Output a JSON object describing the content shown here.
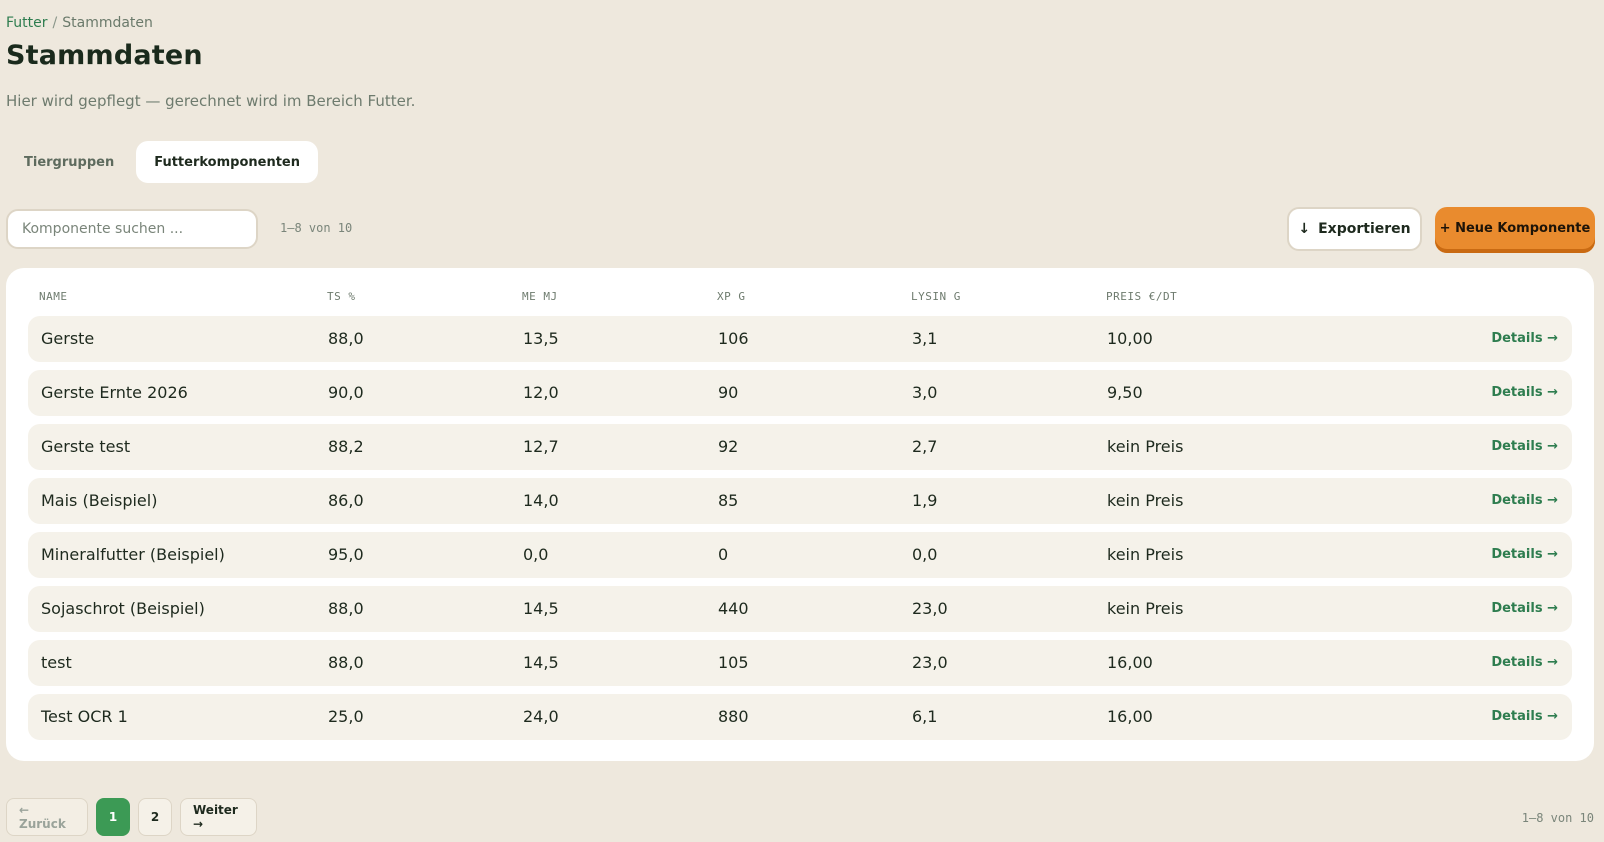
{
  "breadcrumb": {
    "parent": "Futter",
    "separator": "/",
    "current": "Stammdaten"
  },
  "page": {
    "title": "Stammdaten",
    "subtitle": "Hier wird gepflegt — gerechnet wird im Bereich Futter."
  },
  "tabs": [
    {
      "label": "Tiergruppen",
      "active": false
    },
    {
      "label": "Futterkomponenten",
      "active": true
    }
  ],
  "toolbar": {
    "search_placeholder": "Komponente suchen ...",
    "search_value": "",
    "range_text": "1–8 von 10",
    "export_icon": "↓",
    "export_label": "Exportieren",
    "new_label": "+ Neue Komponente"
  },
  "table": {
    "headers": [
      "NAME",
      "TS %",
      "ME MJ",
      "XP G",
      "LYSIN G",
      "PREIS €/DT"
    ],
    "details_label": "Details →",
    "rows": [
      {
        "name": "Gerste",
        "ts": "88,0",
        "me": "13,5",
        "xp": "106",
        "lysin": "3,1",
        "preis": "10,00"
      },
      {
        "name": "Gerste Ernte 2026",
        "ts": "90,0",
        "me": "12,0",
        "xp": "90",
        "lysin": "3,0",
        "preis": "9,50"
      },
      {
        "name": "Gerste test",
        "ts": "88,2",
        "me": "12,7",
        "xp": "92",
        "lysin": "2,7",
        "preis": "kein Preis"
      },
      {
        "name": "Mais (Beispiel)",
        "ts": "86,0",
        "me": "14,0",
        "xp": "85",
        "lysin": "1,9",
        "preis": "kein Preis"
      },
      {
        "name": "Mineralfutter (Beispiel)",
        "ts": "95,0",
        "me": "0,0",
        "xp": "0",
        "lysin": "0,0",
        "preis": "kein Preis"
      },
      {
        "name": "Sojaschrot (Beispiel)",
        "ts": "88,0",
        "me": "14,5",
        "xp": "440",
        "lysin": "23,0",
        "preis": "kein Preis"
      },
      {
        "name": "test",
        "ts": "88,0",
        "me": "14,5",
        "xp": "105",
        "lysin": "23,0",
        "preis": "16,00"
      },
      {
        "name": "Test OCR 1",
        "ts": "25,0",
        "me": "24,0",
        "xp": "880",
        "lysin": "6,1",
        "preis": "16,00"
      }
    ]
  },
  "pagination": {
    "prev_label": "← Zurück",
    "pages": [
      "1",
      "2"
    ],
    "current_page": "1",
    "next_label": "Weiter →",
    "range_text": "1–8 von 10"
  },
  "colors": {
    "background": "#EEE8DD",
    "accent_green": "#2E7D4F",
    "active_page": "#3C9A55",
    "primary_orange": "#E98B2E"
  }
}
